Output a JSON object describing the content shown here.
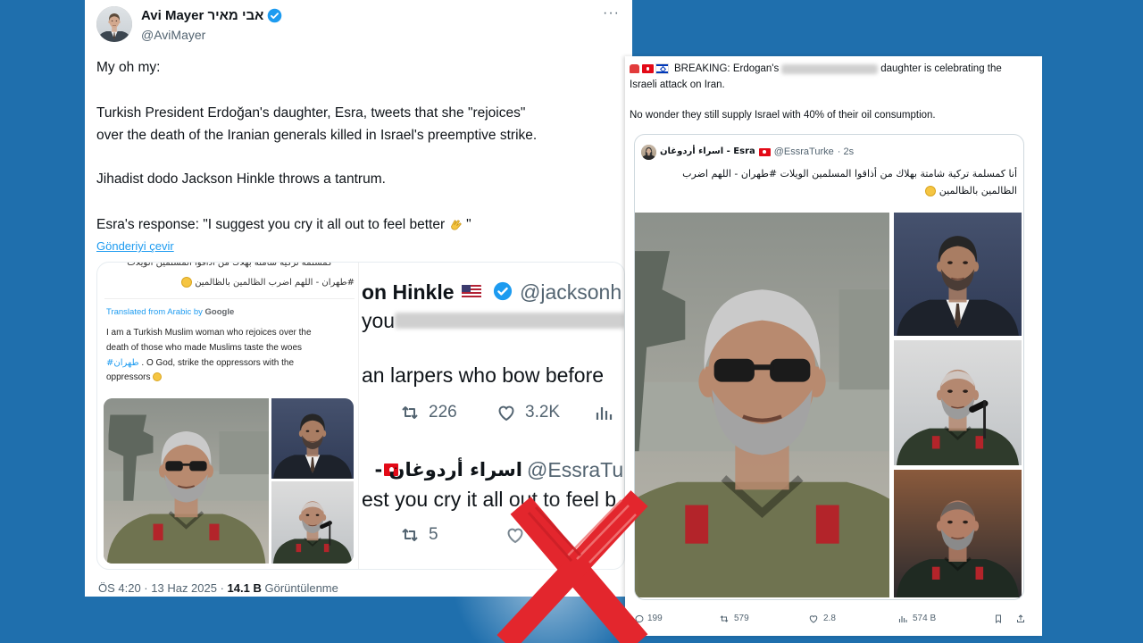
{
  "colors": {
    "background": "#1f6fad",
    "card": "#ffffff",
    "text": "#0f1419",
    "muted": "#536471",
    "link_blue": "#1d9bf0",
    "x_mark_red": "#e3262d"
  },
  "icons": {
    "verified": "verified-badge-icon",
    "repost": "repost-icon",
    "like": "heart-icon",
    "views": "views-chart-icon",
    "reply": "reply-icon",
    "bookmark": "bookmark-icon",
    "share": "share-icon",
    "flags": [
      "turkey-flag-icon",
      "israel-flag-icon",
      "us-flag-icon"
    ],
    "emoji": [
      "clapping-hands-emoji-icon",
      "laughing-emoji-icon"
    ],
    "overlay": "red-x-mark"
  },
  "left_tweet": {
    "author_name": "Avi Mayer אבי מאיר",
    "handle": "@AviMayer",
    "more_label": "···",
    "lines": [
      "My oh my:",
      "Turkish President Erdoğan's daughter, Esra, tweets that she \"rejoices\"",
      "over the death of the Iranian generals killed in Israel's preemptive strike.",
      "Jihadist dodo Jackson Hinkle throws a tantrum.",
      "Esra's response: \"I suggest you cry it all out to feel better"
    ],
    "line_5_close": "\"",
    "translate_link": "Gönderiyi çevir",
    "media": {
      "quote": {
        "arabic_line_1": "كمسلمة تركية شامتة بهلاك من أذاقوا المسلمين الويلات",
        "arabic_line_2": "#طهران - اللهم اضرب الظالمين بالظالمين",
        "translated_by": "Translated from Arabic by",
        "translator": "Google",
        "translation_line_1": "I am a Turkish Muslim woman who rejoices over the",
        "translation_line_2": "death of those who made Muslims taste the woes",
        "translation_hashtag": "#طهران",
        "translation_line_3": ". O God, strike the oppressors with the",
        "translation_line_4": "oppressors"
      },
      "zoom": {
        "name_fragment": "on Hinkle",
        "handle_fragment": "@jacksonh",
        "line_1": "you",
        "line_2": "an larpers who bow before",
        "reposts": "226",
        "likes": "3.2K",
        "reply_name": "اسراء أردوغان -",
        "reply_handle": "@EssraTur",
        "reply_text": "est you cry it all out to feel b",
        "reply_reposts": "5"
      }
    },
    "footer": {
      "time": "ÖS 4:20 · 13 Haz 2025 ·",
      "views": "14.1 B",
      "views_label": "Görüntülenme"
    }
  },
  "right_tweet": {
    "breaking_prefix": "BREAKING: Erdogan's",
    "breaking_suffix": "daughter is celebrating the",
    "line_2": "Israeli attack on Iran.",
    "line_3": "No wonder they still supply Israel with 40% of their oil consumption.",
    "quote": {
      "name": "اسراء أردوغان - Esra",
      "handle": "@EssraTurke",
      "time": "· 2s",
      "text_line_1": "أنا كمسلمة تركية شامتة بهلاك من أذاقوا المسلمين الويلات #طهران - اللهم اضرب",
      "text_line_2": "الظالمين بالظالمين"
    },
    "actions": {
      "replies": "199",
      "reposts": "579",
      "likes": "2.8",
      "views": "574 B"
    }
  }
}
